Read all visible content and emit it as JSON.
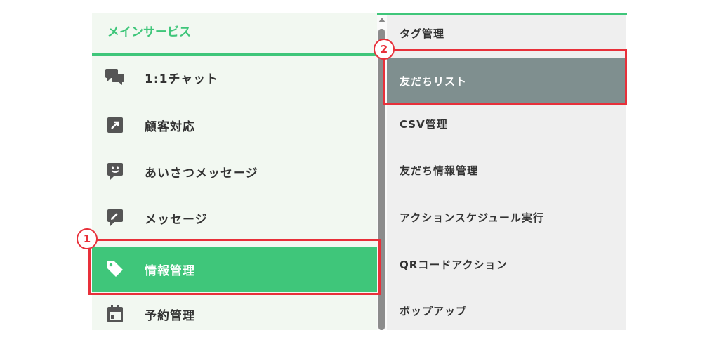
{
  "left_menu": {
    "header": "メインサービス",
    "items": [
      {
        "label": "1:1チャット",
        "icon": "chat-bubbles-icon"
      },
      {
        "label": "顧客対応",
        "icon": "arrow-up-right-icon"
      },
      {
        "label": "あいさつメッセージ",
        "icon": "smile-message-icon"
      },
      {
        "label": "メッセージ",
        "icon": "pencil-message-icon"
      },
      {
        "label": "情報管理",
        "icon": "tag-icon",
        "active": true
      },
      {
        "label": "予約管理",
        "icon": "calendar-icon"
      }
    ]
  },
  "right_menu": {
    "items": [
      {
        "label": "タグ管理"
      },
      {
        "label": "友だちリスト",
        "active": true
      },
      {
        "label": "CSV管理"
      },
      {
        "label": "友だち情報管理"
      },
      {
        "label": "アクションスケジュール実行"
      },
      {
        "label": "QRコードアクション"
      },
      {
        "label": "ポップアップ"
      }
    ]
  },
  "annotations": {
    "badge1": "1",
    "badge2": "2"
  },
  "colors": {
    "accent_green": "#3fc67a",
    "active_gray": "#7f8f8f",
    "highlight_red": "#e8303a"
  }
}
